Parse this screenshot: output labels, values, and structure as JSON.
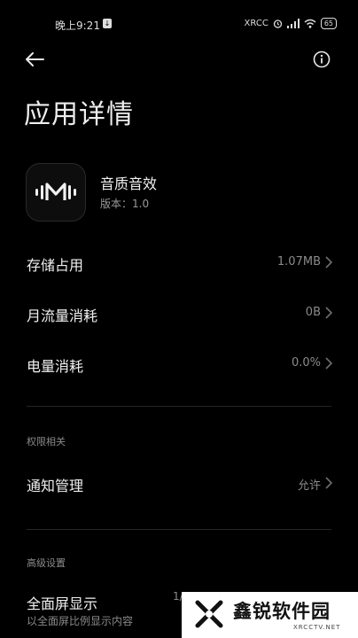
{
  "status_bar": {
    "time": "晚上9:21",
    "download_indicator": "↓",
    "network_label": "XRCC",
    "battery": "65"
  },
  "header": {
    "back_icon": "back-arrow-icon",
    "info_icon": "info-icon",
    "title": "应用详情"
  },
  "app": {
    "icon": "sound-wave-icon",
    "name": "音质音效",
    "version": "版本：1.0"
  },
  "rows": [
    {
      "label": "存储占用",
      "value": "1.07MB"
    },
    {
      "label": "月流量消耗",
      "value": "0B"
    },
    {
      "label": "电量消耗",
      "value": "0.0%"
    }
  ],
  "permissions": {
    "section_title": "权限相关",
    "notification_label": "通知管理",
    "notification_value": "允许"
  },
  "advanced": {
    "section_title": "高级设置",
    "fullscreen_title": "全面屏显示",
    "fullscreen_desc": "以全面屏比例显示内容",
    "fullscreen_value": "1/"
  },
  "watermark": {
    "brand": "鑫锐软件园",
    "sub": "XRCCTV.NET"
  },
  "colors": {
    "background": "#000000",
    "primary_text": "#f0f0f0",
    "secondary_text": "#8a8a8a",
    "divider": "#262626"
  }
}
